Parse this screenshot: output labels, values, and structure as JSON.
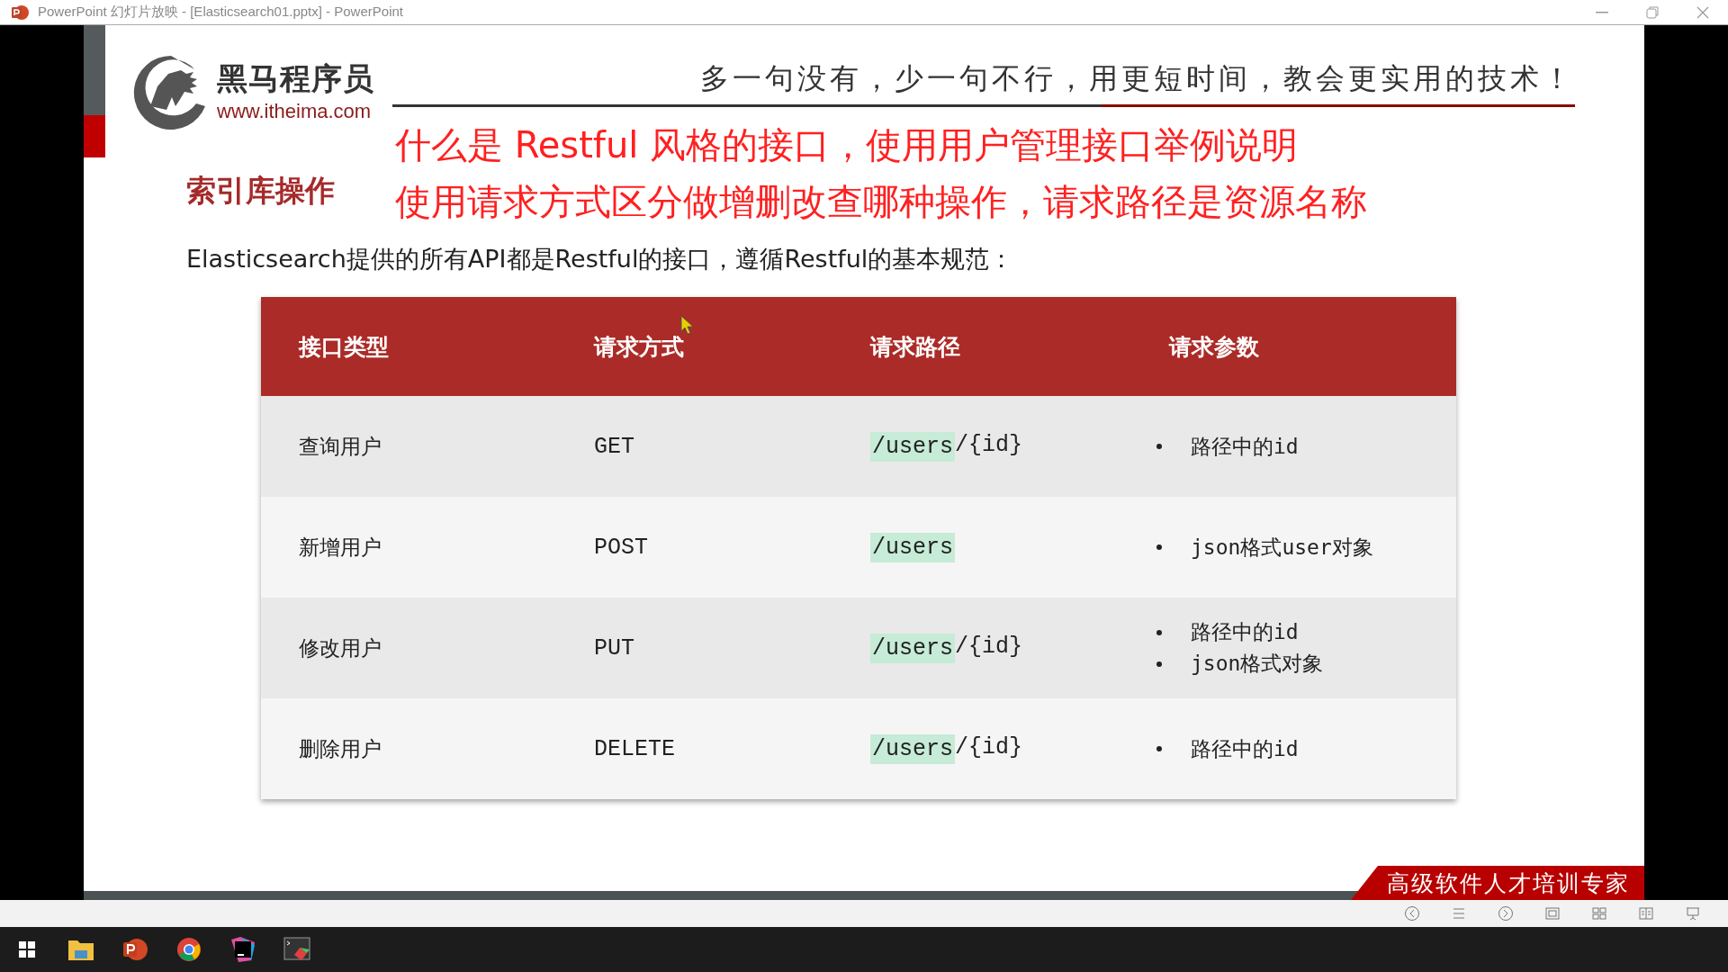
{
  "window": {
    "title": "PowerPoint 幻灯片放映 - [Elasticsearch01.pptx] - PowerPoint"
  },
  "slide": {
    "logo": {
      "name": "黑马程序员",
      "url": "www.itheima.com"
    },
    "slogan": "多一句没有，少一句不行，用更短时间，教会更实用的技术！",
    "annotations": [
      "什么是 Restful 风格的接口，使用用户管理接口举例说明",
      "使用请求方式区分做增删改查哪种操作，请求路径是资源名称"
    ],
    "section_title": "索引库操作",
    "intro": "Elasticsearch提供的所有API都是Restful的接口，遵循Restful的基本规范：",
    "table": {
      "columns": [
        "接口类型",
        "请求方式",
        "请求路径",
        "请求参数"
      ],
      "rows": [
        {
          "type": "查询用户",
          "method": "GET",
          "path_highlight": "/users",
          "path_rest": "/{id}",
          "params": [
            "路径中的id"
          ]
        },
        {
          "type": "新增用户",
          "method": "POST",
          "path_highlight": "/users",
          "params": [
            "json格式user对象"
          ]
        },
        {
          "type": "修改用户",
          "method": "PUT",
          "path_highlight": "/users",
          "path_rest": "/{id}",
          "params": [
            "路径中的id",
            "json格式对象"
          ]
        },
        {
          "type": "删除用户",
          "method": "DELETE",
          "path_highlight": "/users",
          "path_rest": "/{id}",
          "params": [
            "路径中的id"
          ]
        }
      ]
    },
    "banner": "高级软件人才培训专家"
  }
}
